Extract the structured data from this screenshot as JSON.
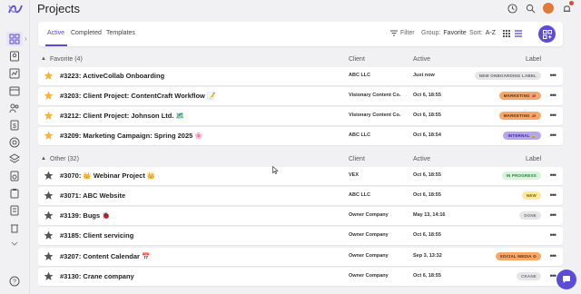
{
  "app": {
    "title": "Projects"
  },
  "tabs": [
    "Active",
    "Completed",
    "Templates"
  ],
  "toolbar": {
    "filter_label": "Filter",
    "group_label": "Group:",
    "group_value": "Favorite",
    "sort_label": "Sort:",
    "sort_value": "A-Z"
  },
  "columns": {
    "client": "Client",
    "active": "Active",
    "label": "Label"
  },
  "groups": [
    {
      "title": "Favorite (4)",
      "rows": [
        {
          "name": "#3223: ActiveCollab Onboarding",
          "client": "ABC LLC",
          "active": "Just now",
          "label": "NEW ONBOARDING LABEL",
          "label_bg": "#e6e6e8",
          "label_fg": "#666666",
          "starred": true
        },
        {
          "name": "#3203: Client Project: ContentCraft Workflow 📝",
          "client": "Visionary Content Co.",
          "active": "Oct 6, 18:55",
          "label": "MARKETING 📣",
          "label_bg": "#f6a86a",
          "label_fg": "#5a2e10",
          "starred": true
        },
        {
          "name": "#3212: Client Project: Johnson Ltd. 🗺️",
          "client": "Visionary Content Co.",
          "active": "Oct 6, 18:55",
          "label": "MARKETING 📣",
          "label_bg": "#f6a86a",
          "label_fg": "#5a2e10",
          "starred": true
        },
        {
          "name": "#3209: Marketing Campaign: Spring 2025 🌸",
          "client": "ABC LLC",
          "active": "Oct 6, 18:54",
          "label": "INTERNAL 🔒",
          "label_bg": "#b7a6ef",
          "label_fg": "#3b2a8a",
          "starred": true
        }
      ]
    },
    {
      "title": "Other (32)",
      "rows": [
        {
          "name": "#3070: 👑 Webinar Project 👑",
          "client": "VEX",
          "active": "Oct 6, 18:55",
          "label": "IN PROGRESS",
          "label_bg": "#d8f2dc",
          "label_fg": "#2f7a3a",
          "starred": false
        },
        {
          "name": "#3071: ABC Website",
          "client": "ABC LLC",
          "active": "Oct 6, 18:55",
          "label": "NEW",
          "label_bg": "#fbeaa0",
          "label_fg": "#7a6200",
          "starred": false
        },
        {
          "name": "#3139: Bugs 🐞",
          "client": "Owner Company",
          "active": "May 13, 14:16",
          "label": "DONE",
          "label_bg": "#e6e6e8",
          "label_fg": "#777777",
          "starred": false
        },
        {
          "name": "#3185: Client servicing",
          "client": "Owner Company",
          "active": "Oct 6, 18:55",
          "label": "",
          "label_bg": "",
          "label_fg": "",
          "starred": false
        },
        {
          "name": "#3207: Content Calendar 📅",
          "client": "Owner Company",
          "active": "Sep 3, 13:32",
          "label": "SOCIAL MEDIA ⊙",
          "label_bg": "#f6a86a",
          "label_fg": "#5a2e10",
          "starred": false
        },
        {
          "name": "#3130: Crane company",
          "client": "Owner Company",
          "active": "Oct 6, 18:55",
          "label": "CRANE",
          "label_bg": "#e6e6e8",
          "label_fg": "#777777",
          "starred": false
        }
      ]
    }
  ],
  "colors": {
    "accent": "#5b4bd6",
    "star_on": "#f5b731",
    "star_off": "#555555"
  },
  "icons": [
    "logo-icon",
    "grid-icon",
    "contact-icon",
    "chart-icon",
    "calendar-icon",
    "people-icon",
    "invoice-icon",
    "dollar-icon",
    "target-icon",
    "layers-icon",
    "clipboard-icon",
    "document-icon",
    "archive-icon",
    "trash-icon",
    "help-icon",
    "timer-icon",
    "search-icon",
    "bell-icon",
    "filter-icon",
    "plus-icon",
    "chat-icon"
  ]
}
